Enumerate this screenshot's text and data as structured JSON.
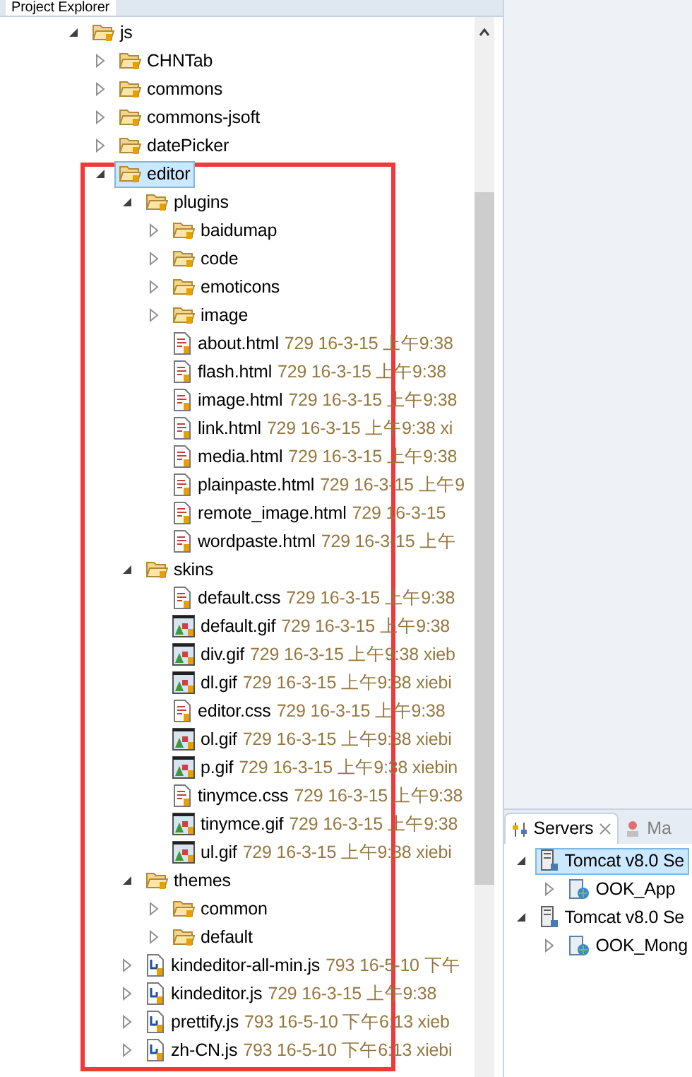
{
  "explorer": {
    "title": "Project Explorer",
    "tree": [
      {
        "label": "js",
        "kind": "folder",
        "expanded": true,
        "selected": false,
        "children": [
          {
            "label": "CHNTab",
            "kind": "folder",
            "expanded": false,
            "selected": false
          },
          {
            "label": "commons",
            "kind": "folder",
            "expanded": false,
            "selected": false
          },
          {
            "label": "commons-jsoft",
            "kind": "folder",
            "expanded": false,
            "selected": false
          },
          {
            "label": "datePicker",
            "kind": "folder",
            "expanded": false,
            "selected": false
          },
          {
            "label": "editor",
            "kind": "folder",
            "expanded": true,
            "selected": true,
            "children": [
              {
                "label": "plugins",
                "kind": "folder",
                "expanded": true,
                "selected": false,
                "children": [
                  {
                    "label": "baidumap",
                    "kind": "folder",
                    "expanded": false,
                    "selected": false
                  },
                  {
                    "label": "code",
                    "kind": "folder",
                    "expanded": false,
                    "selected": false
                  },
                  {
                    "label": "emoticons",
                    "kind": "folder",
                    "expanded": false,
                    "selected": false
                  },
                  {
                    "label": "image",
                    "kind": "folder",
                    "expanded": false,
                    "selected": false
                  },
                  {
                    "label": "about.html",
                    "kind": "page",
                    "selected": false,
                    "decoration": "729 16-3-15 上午9:38"
                  },
                  {
                    "label": "flash.html",
                    "kind": "page",
                    "selected": false,
                    "decoration": "729 16-3-15 上午9:38"
                  },
                  {
                    "label": "image.html",
                    "kind": "page",
                    "selected": false,
                    "decoration": "729 16-3-15 上午9:38"
                  },
                  {
                    "label": "link.html",
                    "kind": "page",
                    "selected": false,
                    "decoration": "729 16-3-15 上午9:38 xi"
                  },
                  {
                    "label": "media.html",
                    "kind": "page",
                    "selected": false,
                    "decoration": "729 16-3-15 上午9:38"
                  },
                  {
                    "label": "plainpaste.html",
                    "kind": "page",
                    "selected": false,
                    "decoration": "729 16-3-15 上午9"
                  },
                  {
                    "label": "remote_image.html",
                    "kind": "page",
                    "selected": false,
                    "decoration": "729 16-3-15"
                  },
                  {
                    "label": "wordpaste.html",
                    "kind": "page",
                    "selected": false,
                    "decoration": "729 16-3-15 上午"
                  }
                ]
              },
              {
                "label": "skins",
                "kind": "folder",
                "expanded": true,
                "selected": false,
                "children": [
                  {
                    "label": "default.css",
                    "kind": "page",
                    "selected": false,
                    "decoration": "729 16-3-15 上午9:38"
                  },
                  {
                    "label": "default.gif",
                    "kind": "image",
                    "selected": false,
                    "decoration": "729 16-3-15 上午9:38"
                  },
                  {
                    "label": "div.gif",
                    "kind": "image",
                    "selected": false,
                    "decoration": "729 16-3-15 上午9:38 xieb"
                  },
                  {
                    "label": "dl.gif",
                    "kind": "image",
                    "selected": false,
                    "decoration": "729 16-3-15 上午9:38 xiebi"
                  },
                  {
                    "label": "editor.css",
                    "kind": "page",
                    "selected": false,
                    "decoration": "729 16-3-15 上午9:38"
                  },
                  {
                    "label": "ol.gif",
                    "kind": "image",
                    "selected": false,
                    "decoration": "729 16-3-15 上午9:38 xiebi"
                  },
                  {
                    "label": "p.gif",
                    "kind": "image",
                    "selected": false,
                    "decoration": "729 16-3-15 上午9:38 xiebin"
                  },
                  {
                    "label": "tinymce.css",
                    "kind": "page",
                    "selected": false,
                    "decoration": "729 16-3-15 上午9:38"
                  },
                  {
                    "label": "tinymce.gif",
                    "kind": "image",
                    "selected": false,
                    "decoration": "729 16-3-15 上午9:38"
                  },
                  {
                    "label": "ul.gif",
                    "kind": "image",
                    "selected": false,
                    "decoration": "729 16-3-15 上午9:38 xiebi"
                  }
                ]
              },
              {
                "label": "themes",
                "kind": "folder",
                "expanded": true,
                "selected": false,
                "children": [
                  {
                    "label": "common",
                    "kind": "folder",
                    "expanded": false,
                    "selected": false
                  },
                  {
                    "label": "default",
                    "kind": "folder",
                    "expanded": false,
                    "selected": false
                  }
                ]
              },
              {
                "label": "kindeditor-all-min.js",
                "kind": "script",
                "expanded": false,
                "selected": false,
                "decoration": "793 16-5-10 下午"
              },
              {
                "label": "kindeditor.js",
                "kind": "script",
                "expanded": false,
                "selected": false,
                "decoration": "729 16-3-15 上午9:38"
              },
              {
                "label": "prettify.js",
                "kind": "script",
                "expanded": false,
                "selected": false,
                "decoration": "793 16-5-10 下午6:13 xieb"
              },
              {
                "label": "zh-CN.js",
                "kind": "script",
                "expanded": false,
                "selected": false,
                "decoration": "793 16-5-10 下午6:13 xiebi"
              }
            ]
          }
        ]
      }
    ]
  },
  "servers": {
    "tabs": [
      {
        "label": "Servers",
        "selected": true
      },
      {
        "label": "Ma",
        "selected": false
      }
    ],
    "tree": [
      {
        "label": "Tomcat v8.0 Se",
        "kind": "server",
        "expanded": true,
        "selected": true,
        "children": [
          {
            "label": "OOK_App",
            "kind": "module",
            "expanded": false,
            "selected": false
          }
        ]
      },
      {
        "label": "Tomcat v8.0 Se",
        "kind": "server",
        "expanded": true,
        "selected": false,
        "children": [
          {
            "label": "OOK_Mong",
            "kind": "module",
            "expanded": false,
            "selected": false
          }
        ]
      }
    ]
  }
}
